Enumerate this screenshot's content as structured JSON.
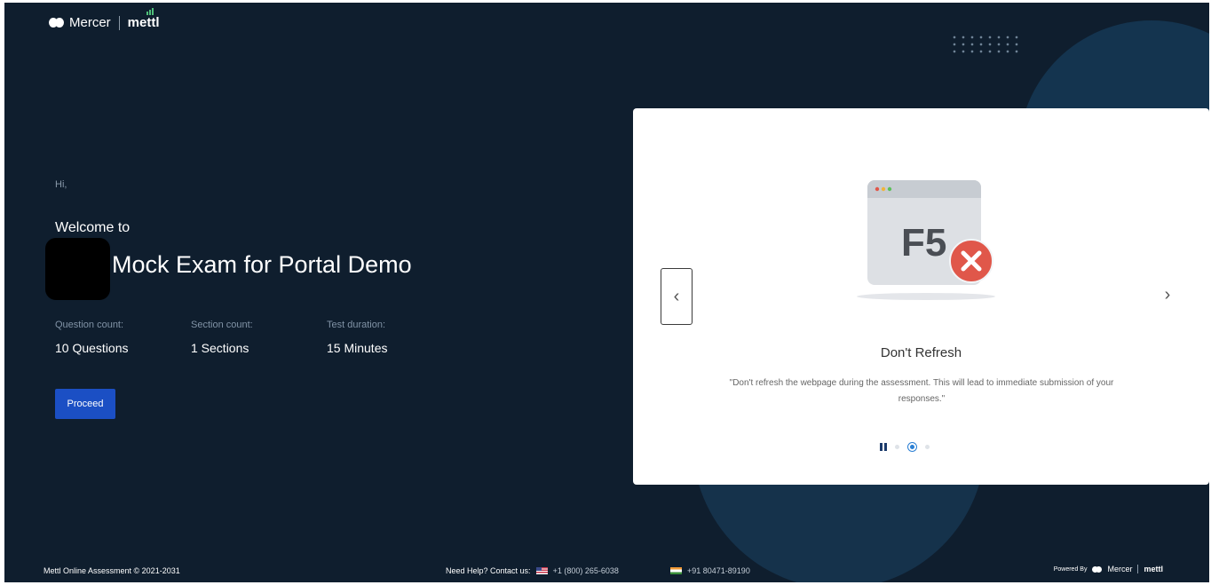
{
  "header": {
    "brand_mercer": "Mercer",
    "brand_mettl": "mettl"
  },
  "intro": {
    "greeting": "Hi,",
    "welcome": "Welcome to",
    "exam_title": "Mock Exam for Portal Demo"
  },
  "stats": [
    {
      "label": "Question count:",
      "value": "10 Questions"
    },
    {
      "label": "Section count:",
      "value": "1 Sections"
    },
    {
      "label": "Test duration:",
      "value": "15 Minutes"
    }
  ],
  "actions": {
    "proceed_label": "Proceed"
  },
  "carousel": {
    "illustration_key": "F5",
    "slide_title": "Don't Refresh",
    "slide_description": "\"Don't refresh the webpage during the assessment. This will lead to immediate submission of your responses.\"",
    "prev_label": "‹",
    "next_label": "›",
    "slide_count": 4,
    "active_slide": 2
  },
  "footer": {
    "copyright": "Mettl Online Assessment © 2021-2031",
    "help_label": "Need Help? Contact us:",
    "phone_us": "+1 (800) 265-6038",
    "phone_in": "+91 80471-89190",
    "powered_by": "Powered By",
    "brand_mercer": "Mercer",
    "brand_mettl": "mettl"
  },
  "colors": {
    "background": "#0f1e2e",
    "accent_button": "#1b4fc4",
    "close_badge": "#e0574a",
    "carousel_active": "#2a7fd4"
  }
}
